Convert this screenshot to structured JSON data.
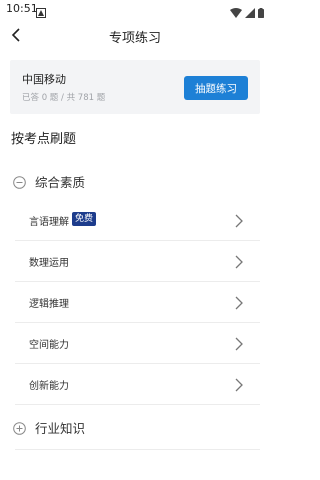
{
  "status_bar": {
    "time": "10:51"
  },
  "nav": {
    "title": "专项练习"
  },
  "summary": {
    "company": "中国移动",
    "progress": "已答 0 题 / 共 781 题",
    "draw_button": "抽题练习"
  },
  "section_heading": "按考点刷题",
  "groups": [
    {
      "label": "综合素质",
      "expanded": true,
      "items": [
        {
          "label": "言语理解",
          "badge": "免费"
        },
        {
          "label": "数理运用"
        },
        {
          "label": "逻辑推理"
        },
        {
          "label": "空间能力"
        },
        {
          "label": "创新能力"
        }
      ]
    },
    {
      "label": "行业知识",
      "expanded": false
    }
  ],
  "colors": {
    "accent": "#1d80d6",
    "badge": "#1d3c8c",
    "card_bg": "#f3f4f6"
  }
}
